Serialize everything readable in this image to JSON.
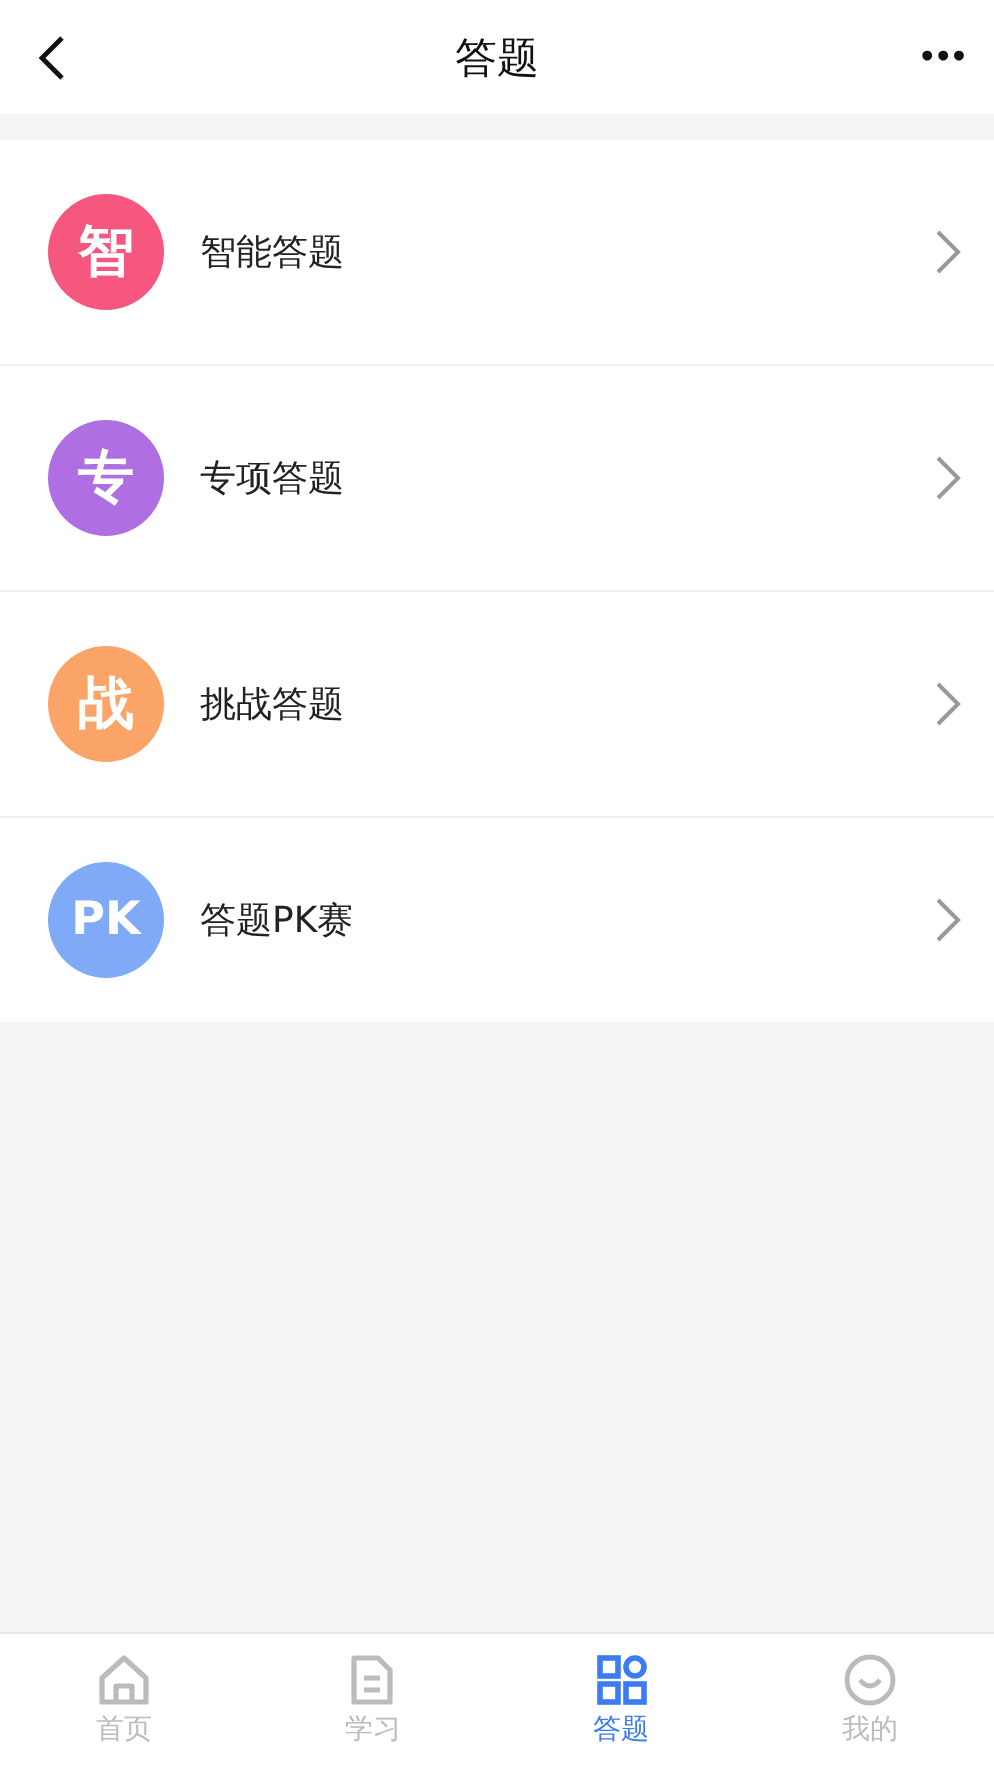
{
  "header": {
    "title": "答题",
    "more": "•••"
  },
  "items": [
    {
      "badge": "智",
      "label": "智能答题",
      "color": "#f5577f"
    },
    {
      "badge": "专",
      "label": "专项答题",
      "color": "#b06ee3"
    },
    {
      "badge": "战",
      "label": "挑战答题",
      "color": "#fba468"
    },
    {
      "badge": "PK",
      "label": "答题PK赛",
      "color": "#80a9f8"
    }
  ],
  "tabs": [
    {
      "kind": "home",
      "label": "首页",
      "selected": false
    },
    {
      "kind": "doc",
      "label": "学习",
      "selected": false
    },
    {
      "kind": "grid",
      "label": "答题",
      "selected": true
    },
    {
      "kind": "smile",
      "label": "我的",
      "selected": false
    }
  ]
}
